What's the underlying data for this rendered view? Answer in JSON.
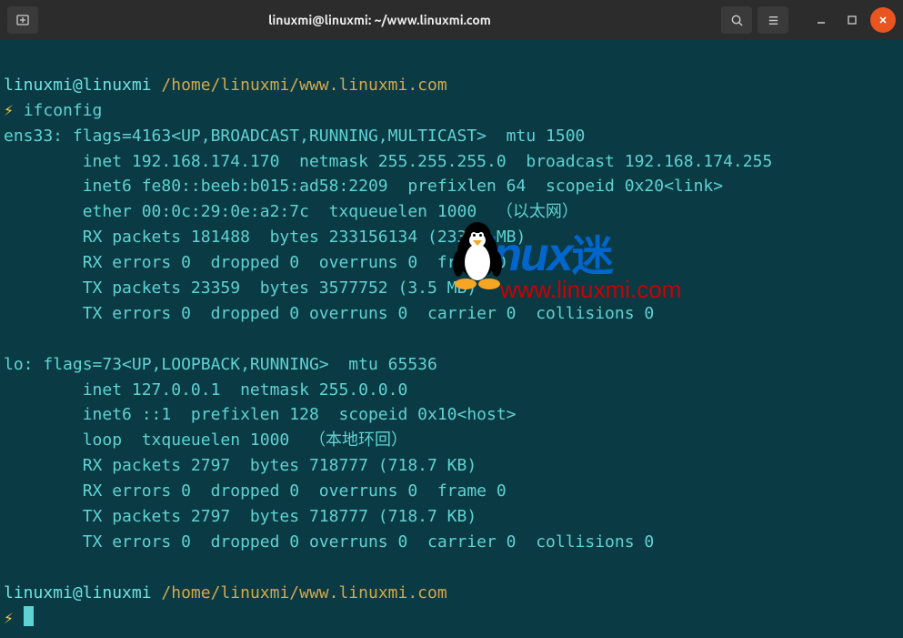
{
  "titlebar": {
    "title": "linuxmi@linuxmi: ~/www.linuxmi.com"
  },
  "prompt1": {
    "user": "linuxmi@linuxmi",
    "path": "/home/linuxmi/www.linuxmi.com",
    "bolt": "⚡",
    "cmd": "ifconfig"
  },
  "output": {
    "l1": "ens33: flags=4163<UP,BROADCAST,RUNNING,MULTICAST>  mtu 1500",
    "l2": "        inet 192.168.174.170  netmask 255.255.255.0  broadcast 192.168.174.255",
    "l3": "        inet6 fe80::beeb:b015:ad58:2209  prefixlen 64  scopeid 0x20<link>",
    "l4": "        ether 00:0c:29:0e:a2:7c  txqueuelen 1000  （以太网）",
    "l5": "        RX packets 181488  bytes 233156134 (233.1 MB)",
    "l6": "        RX errors 0  dropped 0  overruns 0  frame 0",
    "l7": "        TX packets 23359  bytes 3577752 (3.5 MB)",
    "l8": "        TX errors 0  dropped 0 overruns 0  carrier 0  collisions 0",
    "l9": "",
    "l10": "lo: flags=73<UP,LOOPBACK,RUNNING>  mtu 65536",
    "l11": "        inet 127.0.0.1  netmask 255.0.0.0",
    "l12": "        inet6 ::1  prefixlen 128  scopeid 0x10<host>",
    "l13": "        loop  txqueuelen 1000  （本地环回）",
    "l14": "        RX packets 2797  bytes 718777 (718.7 KB)",
    "l15": "        RX errors 0  dropped 0  overruns 0  frame 0",
    "l16": "        TX packets 2797  bytes 718777 (718.7 KB)",
    "l17": "        TX errors 0  dropped 0 overruns 0  carrier 0  collisions 0",
    "l18": ""
  },
  "prompt2": {
    "user": "linuxmi@linuxmi",
    "path": "/home/linuxmi/www.linuxmi.com",
    "bolt": "⚡"
  },
  "watermark": {
    "brand": "Linux",
    "cn": "迷",
    "url": "www.linuxmi.com"
  }
}
